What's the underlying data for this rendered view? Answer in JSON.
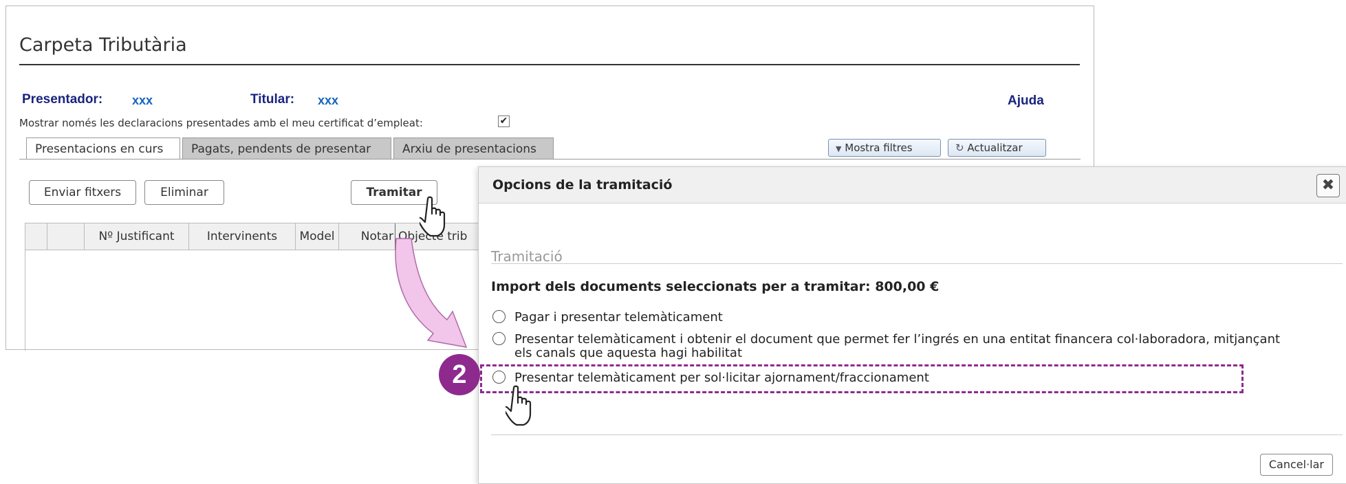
{
  "page": {
    "title": "Carpeta Tributària",
    "presenter_label": "Presentador:",
    "presenter_value": "xxx",
    "holder_label": "Titular:",
    "holder_value": "xxx",
    "help_link": "Ajuda",
    "cert_filter_text": "Mostrar només les declaracions presentades amb el meu certificat d’empleat:",
    "cert_filter_checked": true
  },
  "tabs": [
    {
      "label": "Presentacions en curs",
      "active": true
    },
    {
      "label": "Pagats, pendents de presentar",
      "active": false
    },
    {
      "label": "Arxiu de presentacions",
      "active": false
    }
  ],
  "toolbar": {
    "show_filters": "Mostra filtres",
    "refresh": "Actualitzar",
    "send_files": "Enviar fitxers",
    "delete": "Eliminar",
    "process": "Tramitar"
  },
  "table": {
    "columns": [
      "",
      "",
      "Nº Justificant",
      "Intervinents",
      "Model",
      "Notar",
      "Objecte trib"
    ]
  },
  "dialog": {
    "title": "Opcions de la tramitació",
    "close_icon": "close-icon",
    "section_title": "Tramitació",
    "amount_text": "Import dels documents seleccionats per a tramitar: 800,00 €",
    "options": [
      {
        "line1": "Pagar i presentar telemàticament",
        "line2": ""
      },
      {
        "line1": "Presentar telemàticament i obtenir el document que permet fer l’ingrés en una entitat financera col·laboradora, mitjançant",
        "line2": "els canals que aquesta hagi habilitat"
      },
      {
        "line1": "Presentar telemàticament per sol·licitar ajornament/fraccionament",
        "line2": ""
      }
    ],
    "cancel": "Cancel·lar"
  },
  "annotation": {
    "step_number": "2",
    "accent_color": "#8e2a8e"
  }
}
